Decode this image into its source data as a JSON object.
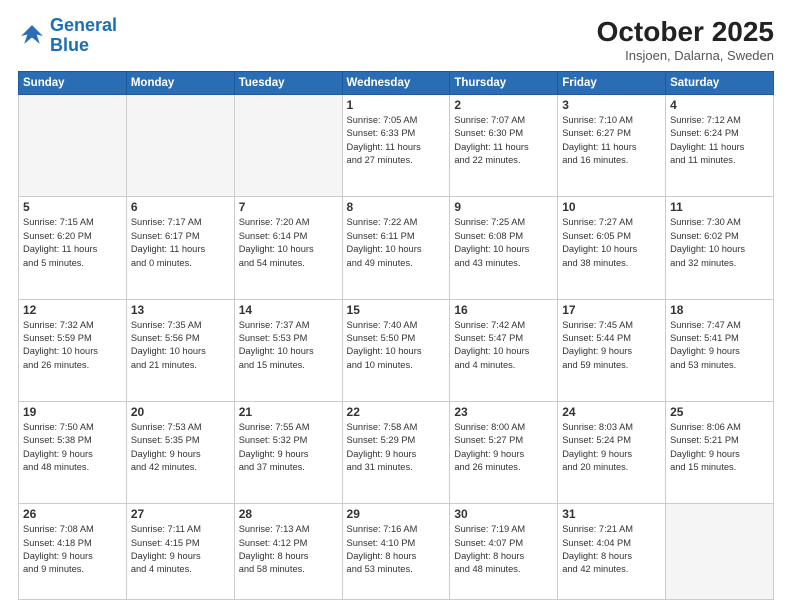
{
  "logo": {
    "line1": "General",
    "line2": "Blue"
  },
  "title": {
    "month_year": "October 2025",
    "location": "Insjoen, Dalarna, Sweden"
  },
  "weekdays": [
    "Sunday",
    "Monday",
    "Tuesday",
    "Wednesday",
    "Thursday",
    "Friday",
    "Saturday"
  ],
  "weeks": [
    [
      {
        "day": "",
        "info": ""
      },
      {
        "day": "",
        "info": ""
      },
      {
        "day": "",
        "info": ""
      },
      {
        "day": "1",
        "info": "Sunrise: 7:05 AM\nSunset: 6:33 PM\nDaylight: 11 hours\nand 27 minutes."
      },
      {
        "day": "2",
        "info": "Sunrise: 7:07 AM\nSunset: 6:30 PM\nDaylight: 11 hours\nand 22 minutes."
      },
      {
        "day": "3",
        "info": "Sunrise: 7:10 AM\nSunset: 6:27 PM\nDaylight: 11 hours\nand 16 minutes."
      },
      {
        "day": "4",
        "info": "Sunrise: 7:12 AM\nSunset: 6:24 PM\nDaylight: 11 hours\nand 11 minutes."
      }
    ],
    [
      {
        "day": "5",
        "info": "Sunrise: 7:15 AM\nSunset: 6:20 PM\nDaylight: 11 hours\nand 5 minutes."
      },
      {
        "day": "6",
        "info": "Sunrise: 7:17 AM\nSunset: 6:17 PM\nDaylight: 11 hours\nand 0 minutes."
      },
      {
        "day": "7",
        "info": "Sunrise: 7:20 AM\nSunset: 6:14 PM\nDaylight: 10 hours\nand 54 minutes."
      },
      {
        "day": "8",
        "info": "Sunrise: 7:22 AM\nSunset: 6:11 PM\nDaylight: 10 hours\nand 49 minutes."
      },
      {
        "day": "9",
        "info": "Sunrise: 7:25 AM\nSunset: 6:08 PM\nDaylight: 10 hours\nand 43 minutes."
      },
      {
        "day": "10",
        "info": "Sunrise: 7:27 AM\nSunset: 6:05 PM\nDaylight: 10 hours\nand 38 minutes."
      },
      {
        "day": "11",
        "info": "Sunrise: 7:30 AM\nSunset: 6:02 PM\nDaylight: 10 hours\nand 32 minutes."
      }
    ],
    [
      {
        "day": "12",
        "info": "Sunrise: 7:32 AM\nSunset: 5:59 PM\nDaylight: 10 hours\nand 26 minutes."
      },
      {
        "day": "13",
        "info": "Sunrise: 7:35 AM\nSunset: 5:56 PM\nDaylight: 10 hours\nand 21 minutes."
      },
      {
        "day": "14",
        "info": "Sunrise: 7:37 AM\nSunset: 5:53 PM\nDaylight: 10 hours\nand 15 minutes."
      },
      {
        "day": "15",
        "info": "Sunrise: 7:40 AM\nSunset: 5:50 PM\nDaylight: 10 hours\nand 10 minutes."
      },
      {
        "day": "16",
        "info": "Sunrise: 7:42 AM\nSunset: 5:47 PM\nDaylight: 10 hours\nand 4 minutes."
      },
      {
        "day": "17",
        "info": "Sunrise: 7:45 AM\nSunset: 5:44 PM\nDaylight: 9 hours\nand 59 minutes."
      },
      {
        "day": "18",
        "info": "Sunrise: 7:47 AM\nSunset: 5:41 PM\nDaylight: 9 hours\nand 53 minutes."
      }
    ],
    [
      {
        "day": "19",
        "info": "Sunrise: 7:50 AM\nSunset: 5:38 PM\nDaylight: 9 hours\nand 48 minutes."
      },
      {
        "day": "20",
        "info": "Sunrise: 7:53 AM\nSunset: 5:35 PM\nDaylight: 9 hours\nand 42 minutes."
      },
      {
        "day": "21",
        "info": "Sunrise: 7:55 AM\nSunset: 5:32 PM\nDaylight: 9 hours\nand 37 minutes."
      },
      {
        "day": "22",
        "info": "Sunrise: 7:58 AM\nSunset: 5:29 PM\nDaylight: 9 hours\nand 31 minutes."
      },
      {
        "day": "23",
        "info": "Sunrise: 8:00 AM\nSunset: 5:27 PM\nDaylight: 9 hours\nand 26 minutes."
      },
      {
        "day": "24",
        "info": "Sunrise: 8:03 AM\nSunset: 5:24 PM\nDaylight: 9 hours\nand 20 minutes."
      },
      {
        "day": "25",
        "info": "Sunrise: 8:06 AM\nSunset: 5:21 PM\nDaylight: 9 hours\nand 15 minutes."
      }
    ],
    [
      {
        "day": "26",
        "info": "Sunrise: 7:08 AM\nSunset: 4:18 PM\nDaylight: 9 hours\nand 9 minutes."
      },
      {
        "day": "27",
        "info": "Sunrise: 7:11 AM\nSunset: 4:15 PM\nDaylight: 9 hours\nand 4 minutes."
      },
      {
        "day": "28",
        "info": "Sunrise: 7:13 AM\nSunset: 4:12 PM\nDaylight: 8 hours\nand 58 minutes."
      },
      {
        "day": "29",
        "info": "Sunrise: 7:16 AM\nSunset: 4:10 PM\nDaylight: 8 hours\nand 53 minutes."
      },
      {
        "day": "30",
        "info": "Sunrise: 7:19 AM\nSunset: 4:07 PM\nDaylight: 8 hours\nand 48 minutes."
      },
      {
        "day": "31",
        "info": "Sunrise: 7:21 AM\nSunset: 4:04 PM\nDaylight: 8 hours\nand 42 minutes."
      },
      {
        "day": "",
        "info": ""
      }
    ]
  ]
}
